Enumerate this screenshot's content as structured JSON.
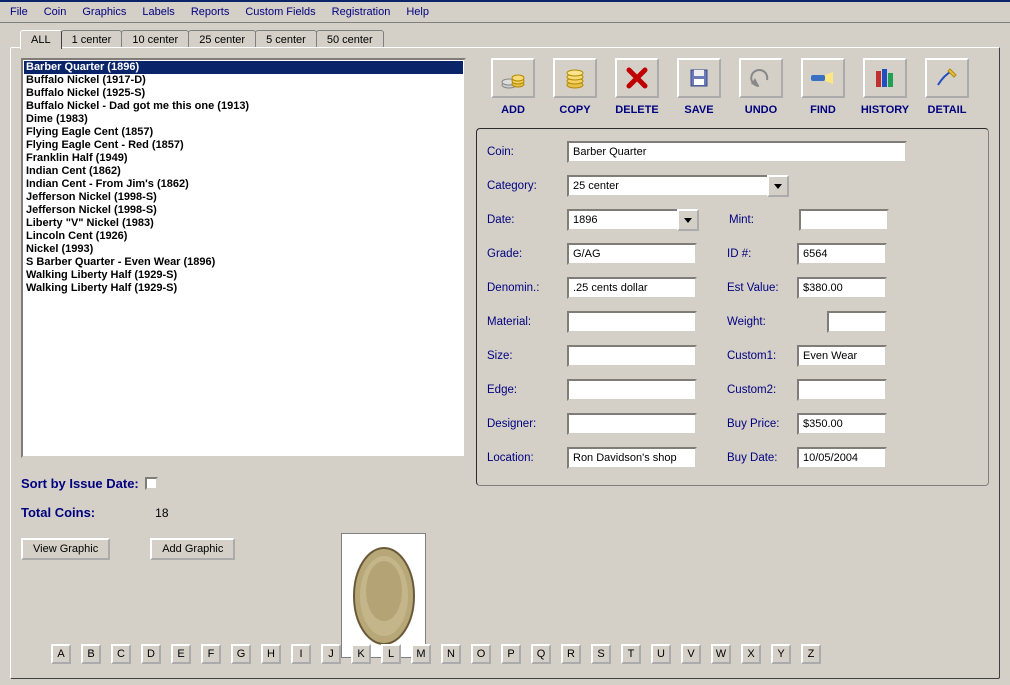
{
  "menu": [
    "File",
    "Coin",
    "Graphics",
    "Labels",
    "Reports",
    "Custom Fields",
    "Registration",
    "Help"
  ],
  "tabs": [
    "ALL",
    "1 center",
    "10 center",
    "25 center",
    "5 center",
    "50 center"
  ],
  "active_tab": 0,
  "coin_list": [
    "Barber Quarter (1896)",
    "Buffalo Nickel (1917-D)",
    "Buffalo Nickel (1925-S)",
    "Buffalo Nickel - Dad got me this one (1913)",
    "Dime (1983)",
    "Flying Eagle Cent (1857)",
    "Flying Eagle Cent - Red (1857)",
    "Franklin Half (1949)",
    "Indian Cent (1862)",
    "Indian Cent - From Jim's (1862)",
    "Jefferson Nickel (1998-S)",
    "Jefferson Nickel (1998-S)",
    "Liberty \"V\" Nickel (1983)",
    "Lincoln Cent (1926)",
    "Nickel (1993)",
    "S Barber Quarter - Even Wear (1896)",
    "Walking Liberty Half (1929-S)",
    "Walking Liberty Half (1929-S)"
  ],
  "selected_index": 0,
  "sort_label": "Sort by Issue Date:",
  "total_label": "Total Coins:",
  "total_value": "18",
  "buttons": {
    "view_graphic": "View Graphic",
    "add_graphic": "Add Graphic"
  },
  "toolbar": {
    "add": "ADD",
    "copy": "COPY",
    "delete": "DELETE",
    "save": "SAVE",
    "undo": "UNDO",
    "find": "FIND",
    "history": "HISTORY",
    "detail": "DETAIL"
  },
  "form": {
    "coin_label": "Coin:",
    "coin": "Barber Quarter",
    "category_label": "Category:",
    "category": "25 center",
    "date_label": "Date:",
    "date": "1896",
    "mint_label": "Mint:",
    "mint": "",
    "grade_label": "Grade:",
    "grade": "G/AG",
    "id_label": "ID #:",
    "id": "6564",
    "denom_label": "Denomin.:",
    "denom": ".25 cents dollar",
    "estvalue_label": "Est Value:",
    "estvalue": "$380.00",
    "material_label": "Material:",
    "material": "",
    "weight_label": "Weight:",
    "weight": "",
    "size_label": "Size:",
    "size": "",
    "custom1_label": "Custom1:",
    "custom1": "Even Wear",
    "edge_label": "Edge:",
    "edge": "",
    "custom2_label": "Custom2:",
    "custom2": "",
    "designer_label": "Designer:",
    "designer": "",
    "buyprice_label": "Buy Price:",
    "buyprice": "$350.00",
    "location_label": "Location:",
    "location": "Ron Davidson's shop",
    "buydate_label": "Buy Date:",
    "buydate": "10/05/2004"
  },
  "alpha": [
    "A",
    "B",
    "C",
    "D",
    "E",
    "F",
    "G",
    "H",
    "I",
    "J",
    "K",
    "L",
    "M",
    "N",
    "O",
    "P",
    "Q",
    "R",
    "S",
    "T",
    "U",
    "V",
    "W",
    "X",
    "Y",
    "Z"
  ]
}
